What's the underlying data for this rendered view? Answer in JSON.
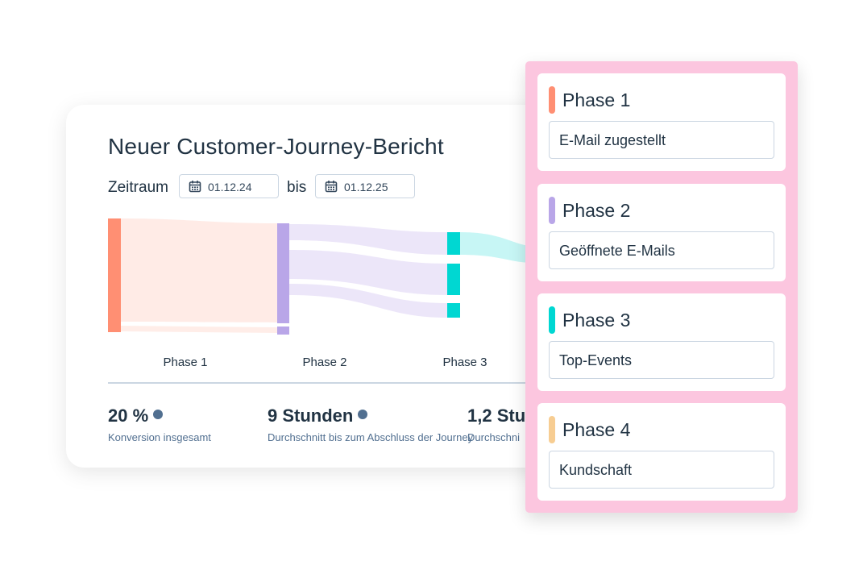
{
  "report": {
    "title": "Neuer Customer-Journey-Bericht",
    "date_range": {
      "label": "Zeitraum",
      "from": "01.12.24",
      "separator": "bis",
      "to": "01.12.25",
      "icon": "calendar-icon"
    },
    "phases": [
      "Phase 1",
      "Phase 2",
      "Phase 3"
    ],
    "stats": [
      {
        "value": "20 %",
        "caption": "Konversion insgesamt"
      },
      {
        "value": "9 Stunden",
        "caption": "Durchschnitt bis zum Abschluss der Journey"
      },
      {
        "value": "1,2 Stu",
        "caption": "Durchschni"
      }
    ]
  },
  "colors": {
    "phase1": "#ff8f73",
    "phase2": "#b9a6e8",
    "phase3": "#00d7d2",
    "phase4": "#f7cd92",
    "panel": "#fcc6df",
    "stat_dot": "#516f90"
  },
  "phase_panel": {
    "cards": [
      {
        "title": "Phase 1",
        "value": "E-Mail zugestellt",
        "color": "#ff8f73"
      },
      {
        "title": "Phase 2",
        "value": "Geöffnete E-Mails",
        "color": "#b9a6e8"
      },
      {
        "title": "Phase 3",
        "value": "Top-Events",
        "color": "#00d7d2"
      },
      {
        "title": "Phase 4",
        "value": "Kundschaft",
        "color": "#f7cd92"
      }
    ]
  }
}
